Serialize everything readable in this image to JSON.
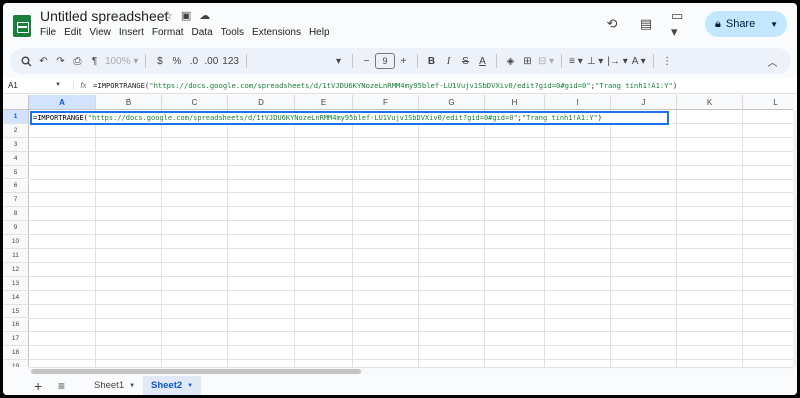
{
  "header": {
    "title": "Untitled spreadsheet",
    "menu": [
      "File",
      "Edit",
      "View",
      "Insert",
      "Format",
      "Data",
      "Tools",
      "Extensions",
      "Help"
    ],
    "share_label": "Share"
  },
  "toolbar": {
    "zoom": "100%",
    "currency": "$",
    "percent": "%",
    "dec_decrease": ".0",
    "dec_increase": ".00",
    "number_format": "123",
    "font_size": "9",
    "bold": "B",
    "italic": "I",
    "strike": "S",
    "text_color": "A"
  },
  "formula_bar": {
    "cell_ref": "A1",
    "fx": "fx",
    "fn": "=IMPORTRANGE(",
    "url": "\"https://docs.google.com/spreadsheets/d/1tVJDU6KYNozeLnRMM4my95blef-LU1Vujv1SbDVXiv0/edit?gid=0#gid=0\"",
    "sep": ";",
    "range": "\"Trang tính1!A1:Y\"",
    "close": ")"
  },
  "grid": {
    "columns": [
      "A",
      "B",
      "C",
      "D",
      "E",
      "F",
      "G",
      "H",
      "I",
      "J",
      "K",
      "L"
    ],
    "rows": [
      "1",
      "2",
      "3",
      "4",
      "5",
      "6",
      "7",
      "8",
      "9",
      "10",
      "11",
      "12",
      "13",
      "14",
      "15",
      "16",
      "17",
      "18",
      "19"
    ],
    "selected_column": "A",
    "selected_row": "1"
  },
  "sheets": {
    "tabs": [
      "Sheet1",
      "Sheet2"
    ],
    "active": "Sheet2"
  },
  "colors": {
    "accent": "#1a73e8",
    "share_bg": "#c2e7ff",
    "string_green": "#188038",
    "logo_green": "#188038"
  }
}
